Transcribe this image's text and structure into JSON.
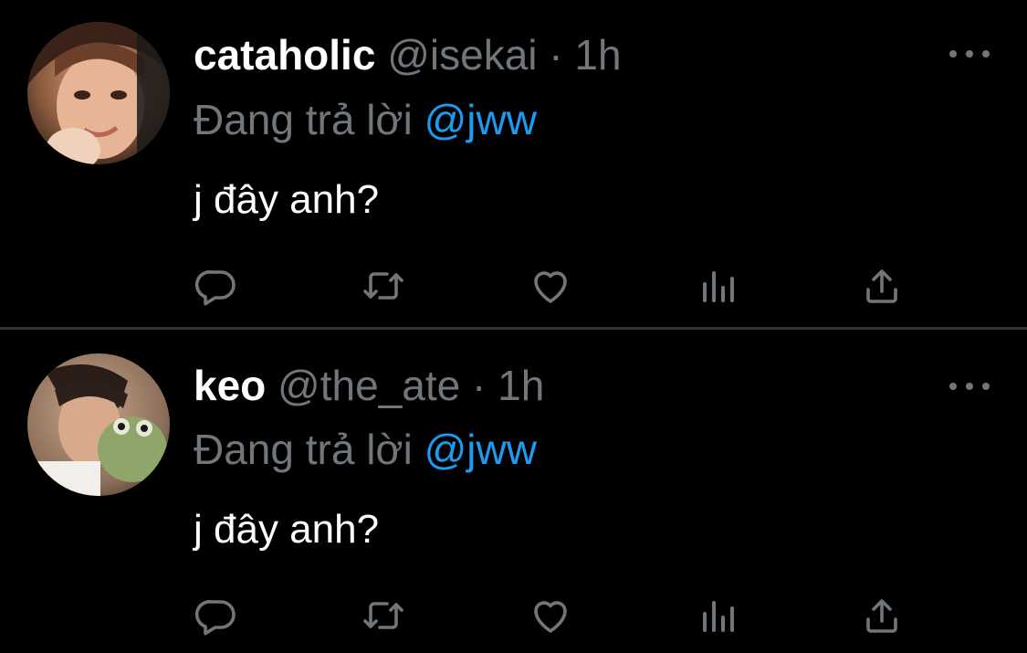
{
  "tweets": [
    {
      "display_name": "cataholic",
      "handle": "@isekai",
      "separator": "·",
      "time": "1h",
      "reply_prefix": "Đang trả lời",
      "reply_to": "@jww",
      "text": "j đây anh?",
      "avatar": "avatar-photo",
      "actions": [
        "reply-icon",
        "retweet-icon",
        "like-icon",
        "views-icon",
        "share-icon"
      ]
    },
    {
      "display_name": "keo",
      "handle": "@the_ate",
      "separator": "·",
      "time": "1h",
      "reply_prefix": "Đang trả lời",
      "reply_to": "@jww",
      "text": "j đây anh?",
      "avatar": "avatar-photo",
      "actions": [
        "reply-icon",
        "retweet-icon",
        "like-icon",
        "views-icon",
        "share-icon"
      ]
    }
  ],
  "colors": {
    "background": "#000000",
    "primary_text": "#ffffff",
    "secondary_text": "#71767b",
    "mention": "#1d9bf0",
    "divider": "#2f3336"
  }
}
